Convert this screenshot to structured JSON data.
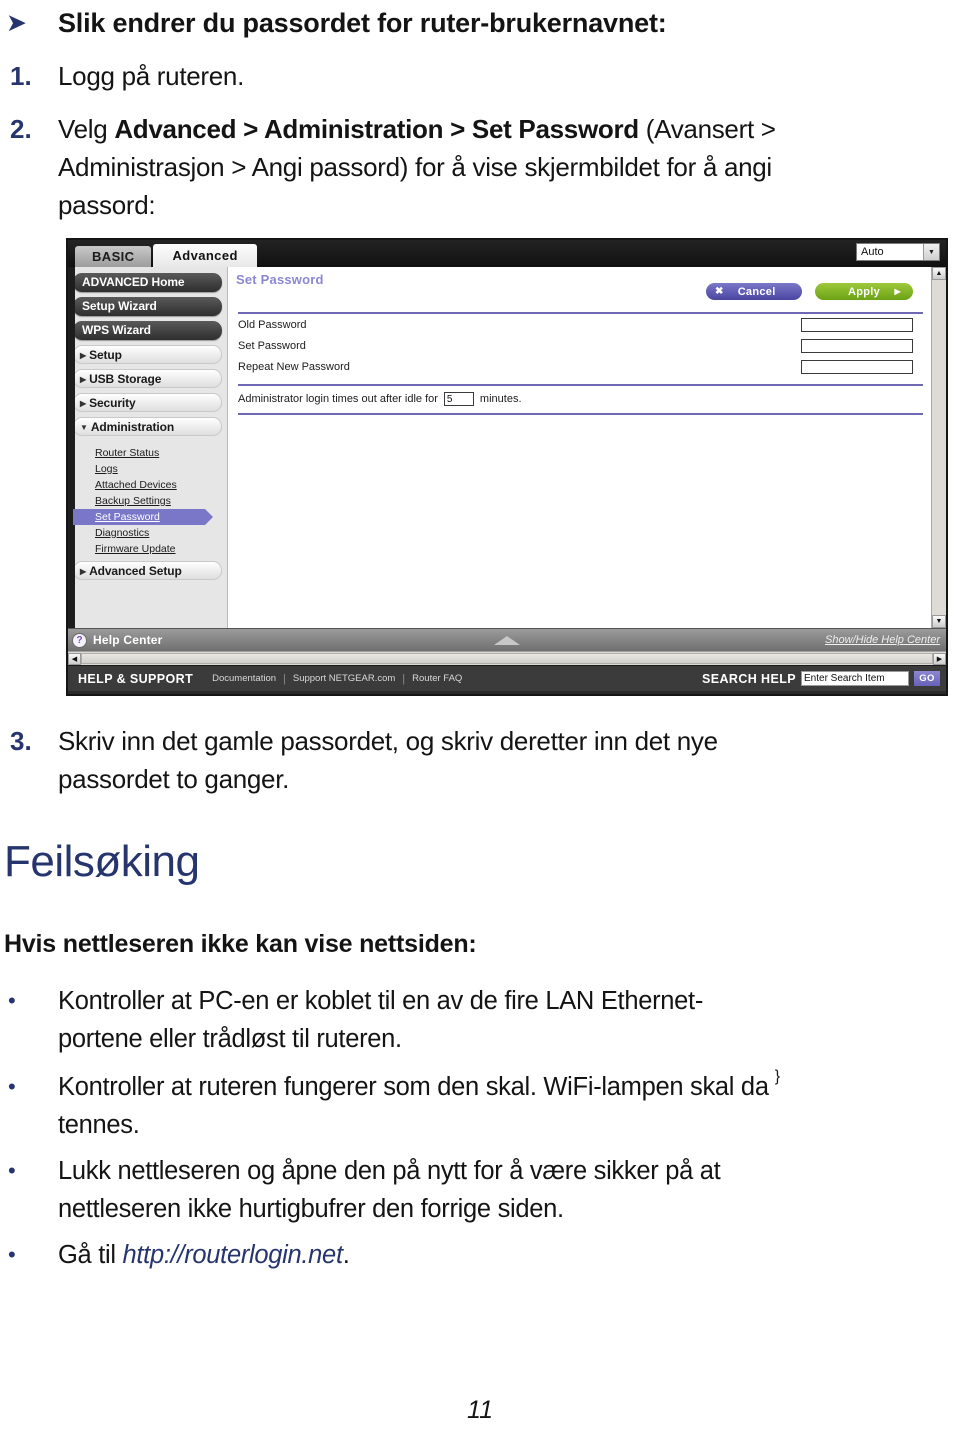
{
  "document": {
    "heading": {
      "bullet_icon": "arrow-bullet-icon",
      "text": "Slik endrer du passordet for ruter-brukernavnet:"
    },
    "steps": [
      {
        "marker": "1.",
        "lines": [
          {
            "segments": [
              {
                "text": "Logg på ruteren.",
                "bold": false
              }
            ]
          }
        ]
      },
      {
        "marker": "2.",
        "lines": [
          {
            "segments": [
              {
                "text": "Velg ",
                "bold": false
              },
              {
                "text": "Advanced > Administration > Set Password",
                "bold": true
              },
              {
                "text": " (Avansert >",
                "bold": false
              }
            ]
          },
          {
            "segments": [
              {
                "text": "Administrasjon > Angi passord) for å vise skjermbildet for å angi",
                "bold": false
              }
            ]
          },
          {
            "segments": [
              {
                "text": "passord:",
                "bold": false
              }
            ]
          }
        ]
      },
      {
        "marker": "3.",
        "lines": [
          {
            "segments": [
              {
                "text": "Skriv inn det gamle passordet, og skriv deretter inn det nye",
                "bold": false
              }
            ]
          },
          {
            "segments": [
              {
                "text": "passordet to ganger.",
                "bold": false
              }
            ]
          }
        ]
      }
    ],
    "section_title": "Feilsøking",
    "sub_title": "Hvis nettleseren ikke kan vise nettsiden:",
    "bullets": [
      {
        "bullet": "•",
        "lines": [
          {
            "segments": [
              {
                "text": "Kontroller at PC-en er koblet til en av de fire LAN Ethernet-",
                "style": "normal"
              }
            ]
          },
          {
            "segments": [
              {
                "text": "portene eller trådløst til ruteren.",
                "style": "normal"
              }
            ]
          }
        ]
      },
      {
        "bullet": "•",
        "lines": [
          {
            "segments": [
              {
                "text": "Kontroller at ruteren fungerer som den skal. WiFi-lampen skal da",
                "style": "normal"
              }
            ]
          },
          {
            "segments": [
              {
                "text": "tennes.",
                "style": "normal"
              }
            ]
          }
        ]
      },
      {
        "bullet": "•",
        "lines": [
          {
            "segments": [
              {
                "text": "Lukk nettleseren og åpne den på nytt for å være sikker på at",
                "style": "normal"
              }
            ]
          },
          {
            "segments": [
              {
                "text": "nettleseren ikke hurtigbufrer den forrige siden.",
                "style": "normal"
              }
            ]
          }
        ]
      },
      {
        "bullet": "•",
        "lines": [
          {
            "segments": [
              {
                "text": "Gå til ",
                "style": "normal"
              },
              {
                "text": "http://routerlogin.net",
                "style": "link"
              },
              {
                "text": ".",
                "style": "normal"
              }
            ]
          }
        ]
      }
    ],
    "page_number": "11"
  },
  "router_figure": {
    "tabs": [
      {
        "label": "BASIC",
        "active": false
      },
      {
        "label": "Advanced",
        "active": true
      }
    ],
    "language_select": {
      "value": "Auto",
      "caret_icon": "chevron-down-icon"
    },
    "sidebar": {
      "primary_buttons": [
        {
          "label": "ADVANCED Home",
          "style": "dark"
        },
        {
          "label": "Setup Wizard",
          "style": "dark"
        },
        {
          "label": "WPS Wizard",
          "style": "dark"
        }
      ],
      "sections": [
        {
          "label": "Setup",
          "expanded": false,
          "arrow_icon": "triangle-right-icon"
        },
        {
          "label": "USB Storage",
          "expanded": false,
          "arrow_icon": "triangle-right-icon"
        },
        {
          "label": "Security",
          "expanded": false,
          "arrow_icon": "triangle-right-icon"
        },
        {
          "label": "Administration",
          "expanded": true,
          "arrow_icon": "triangle-down-icon"
        }
      ],
      "administration_items": [
        {
          "label": "Router Status",
          "selected": false
        },
        {
          "label": "Logs",
          "selected": false
        },
        {
          "label": "Attached Devices",
          "selected": false
        },
        {
          "label": "Backup Settings",
          "selected": false
        },
        {
          "label": "Set Password",
          "selected": true
        },
        {
          "label": "Diagnostics",
          "selected": false
        },
        {
          "label": "Firmware Update",
          "selected": false
        }
      ],
      "last_section": {
        "label": "Advanced Setup",
        "expanded": false,
        "arrow_icon": "triangle-right-icon"
      }
    },
    "main": {
      "page_title": "Set Password",
      "cancel_button": {
        "label": "Cancel",
        "icon": "close-x-icon"
      },
      "apply_button": {
        "label": "Apply",
        "icon": "triangle-right-icon"
      },
      "fields": [
        {
          "label": "Old Password",
          "value": ""
        },
        {
          "label": "Set Password",
          "value": ""
        },
        {
          "label": "Repeat New Password",
          "value": ""
        }
      ],
      "idle_timeout": {
        "prefix": "Administrator login times out after idle for",
        "value": "5",
        "suffix": "minutes."
      }
    },
    "help_bar": {
      "icon": "question-mark-icon",
      "label": "Help Center",
      "collapse_icon": "triangle-up-icon",
      "toggle_label": "Show/Hide Help Center"
    },
    "footer": {
      "title": "HELP & SUPPORT",
      "links": [
        "Documentation",
        "Support NETGEAR.com",
        "Router FAQ"
      ],
      "search_label": "SEARCH HELP",
      "search_placeholder": "Enter Search Item",
      "go_label": "GO"
    },
    "colors": {
      "accent_purple": "#7a76c8",
      "apply_green": "#8cc02e",
      "title_purple": "#8c88cf",
      "dark_chrome": "#2b2b2b"
    }
  }
}
